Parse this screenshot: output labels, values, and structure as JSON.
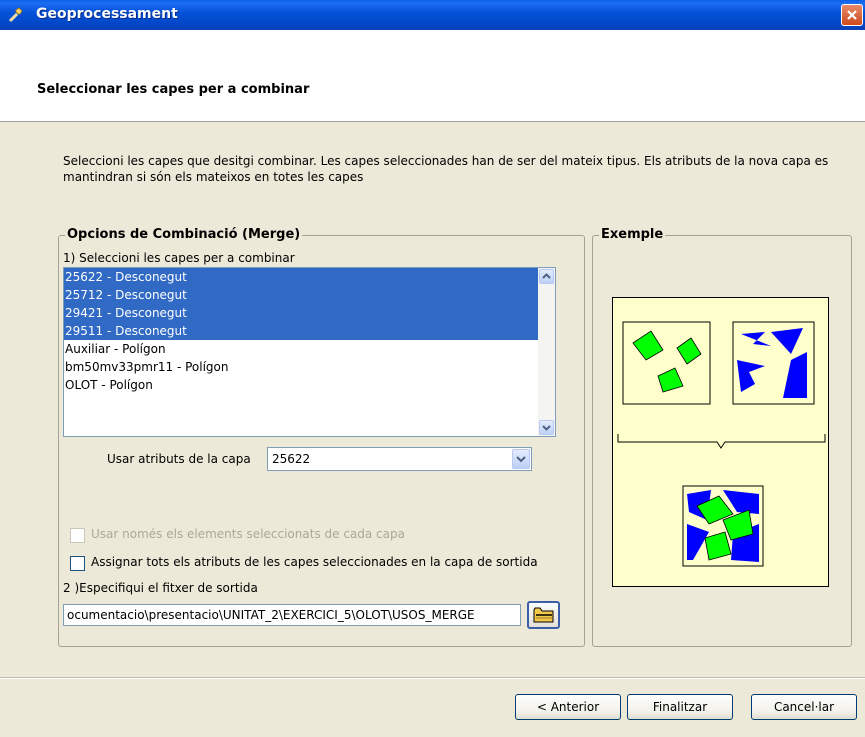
{
  "window": {
    "title": "Geoprocessament"
  },
  "header": {
    "heading": "Seleccionar les capes per a combinar"
  },
  "description": "Seleccioni les capes que desitgi combinar. Les capes seleccionades han de ser del mateix tipus. Els atributs de la nova capa es mantindran si són els mateixos en totes les capes",
  "merge_options": {
    "title": "Opcions de Combinació (Merge)",
    "step1_label": "1) Seleccioni les capes per a combinar",
    "layers": [
      {
        "label": "25622 - Desconegut",
        "selected": true
      },
      {
        "label": "25712 - Desconegut",
        "selected": true
      },
      {
        "label": "29421 - Desconegut",
        "selected": true
      },
      {
        "label": "29511 - Desconegut",
        "selected": true
      },
      {
        "label": "Auxiliar - Polígon",
        "selected": false
      },
      {
        "label": "bm50mv33pmr11 - Polígon",
        "selected": false
      },
      {
        "label": "OLOT - Polígon",
        "selected": false
      }
    ],
    "attributes_label": "Usar atributs de la capa",
    "attributes_value": "25622",
    "only_selected_label": "Usar només els elements seleccionats de cada capa",
    "assign_all_label": "Assignar tots els atributs de les capes seleccionades en la capa de sortida",
    "step2_label": "2 )Especifiqui el fitxer de sortida",
    "output_path": "ocumentacio\\presentacio\\UNITAT_2\\EXERCICI_5\\OLOT\\USOS_MERGE"
  },
  "example": {
    "title": "Exemple"
  },
  "buttons": {
    "previous": "< Anterior",
    "finish": "Finalitzar",
    "cancel": "Cancel·lar"
  },
  "colors": {
    "selection": "#316ac5",
    "green_polygons": "#00ff00",
    "blue_polygons": "#0000ff",
    "example_background": "#ffffcc"
  },
  "icons": {
    "app": "wrench-icon",
    "close": "close-icon",
    "scroll_up": "chevron-up-icon",
    "scroll_down": "chevron-down-icon",
    "dropdown": "chevron-down-icon",
    "browse": "folder-icon"
  }
}
